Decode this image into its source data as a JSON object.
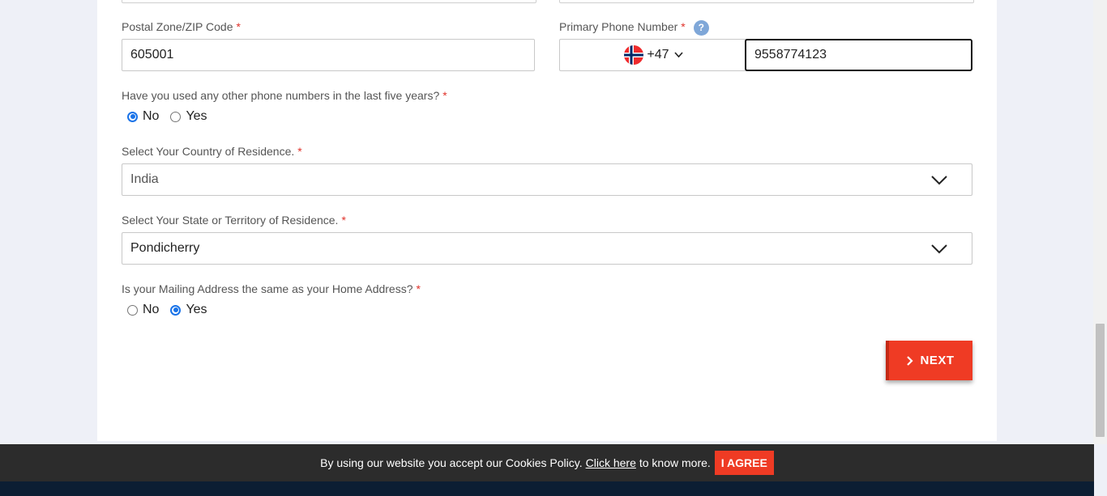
{
  "form": {
    "postal": {
      "label": "Postal Zone/ZIP Code",
      "required": "*",
      "value": "605001"
    },
    "phone": {
      "label": "Primary Phone Number",
      "required": "*",
      "help_icon": "?",
      "country_code": "+47",
      "flag_icon": "norway-flag-icon",
      "value": "9558774123"
    },
    "other_phones": {
      "question": "Have you used any other phone numbers in the last five years?",
      "required": "*",
      "options": [
        "No",
        "Yes"
      ],
      "selected": "No"
    },
    "country": {
      "label": "Select Your Country of Residence.",
      "required": "*",
      "value": "India"
    },
    "state": {
      "label": "Select Your State or Territory of Residence.",
      "required": "*",
      "value": "Pondicherry"
    },
    "mailing_same": {
      "question": "Is your Mailing Address the same as your Home Address?",
      "required": "*",
      "options": [
        "No",
        "Yes"
      ],
      "selected": "Yes"
    },
    "next_button": {
      "label": "NEXT",
      "icon": "chevron-right-icon"
    }
  },
  "cookie": {
    "text_before": "By using our website you accept our Cookies Policy.",
    "link": "Click here",
    "text_after": "to know more.",
    "agree_label": "I AGREE"
  },
  "colors": {
    "accent": "#ef3b24",
    "required": "#e0322a",
    "radio_selected": "#1a73e8",
    "cookie_bar": "#2c2c2c"
  }
}
